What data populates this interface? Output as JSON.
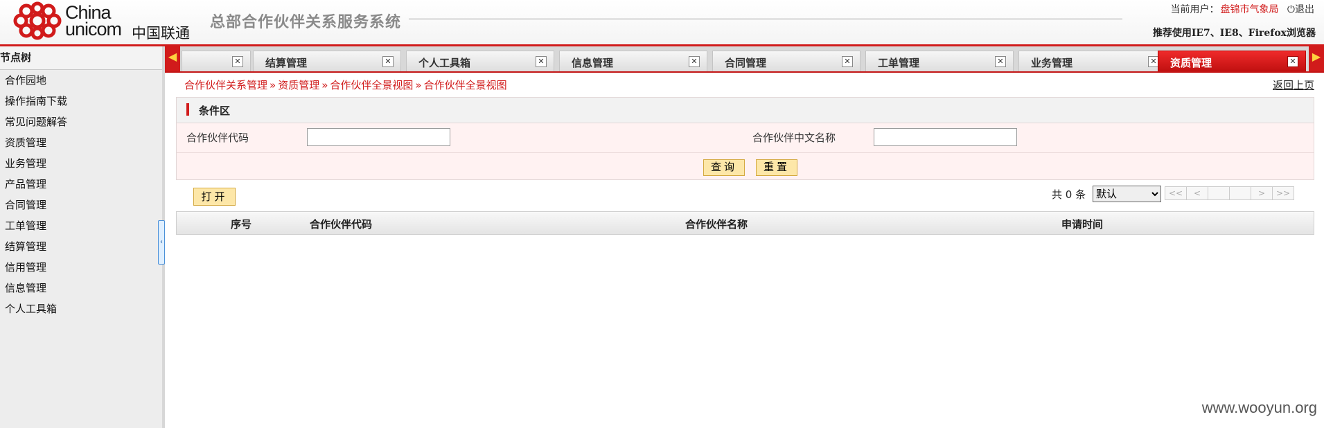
{
  "header": {
    "logo_text_en1": "China",
    "logo_text_en2": "unicom",
    "logo_text_cn": "中国联通",
    "system_title": "总部合作伙伴关系服务系统",
    "current_user_label": "当前用户：",
    "current_user": "盘锦市气象局",
    "logout": "退出",
    "browser_tip": "推荐使用IE7、IE8、Firefox浏览器"
  },
  "sidebar": {
    "title": "节点树",
    "items": [
      "合作园地",
      "操作指南下载",
      "常见问题解答",
      "资质管理",
      "业务管理",
      "产品管理",
      "合同管理",
      "工单管理",
      "结算管理",
      "信用管理",
      "信息管理",
      "个人工具箱"
    ]
  },
  "tabs": [
    {
      "label": ""
    },
    {
      "label": "结算管理"
    },
    {
      "label": "个人工具箱"
    },
    {
      "label": "信息管理"
    },
    {
      "label": "合同管理"
    },
    {
      "label": "工单管理"
    },
    {
      "label": "业务管理"
    },
    {
      "label": "资质管理",
      "active": true
    }
  ],
  "breadcrumb": [
    "合作伙伴关系管理",
    "资质管理",
    "合作伙伴全景视图",
    "合作伙伴全景视图"
  ],
  "back_link": "返回上页",
  "condition": {
    "title": "条件区",
    "field1_label": "合作伙伴代码",
    "field1_value": "",
    "field2_label": "合作伙伴中文名称",
    "field2_value": "",
    "query_button": "查询",
    "reset_button": "重置"
  },
  "toolbar": {
    "open_button": "打开",
    "total": "共 0 条",
    "page_size_selected": "默认",
    "pager": [
      "<<",
      "<",
      "",
      "",
      ">",
      ">>"
    ]
  },
  "table": {
    "columns": [
      "序号",
      "合作伙伴代码",
      "合作伙伴名称",
      "申请时间"
    ]
  },
  "watermark": "www.wooyun.org",
  "colors": {
    "brand_red": "#d11b1b",
    "button_yellow": "#fde7a8"
  }
}
